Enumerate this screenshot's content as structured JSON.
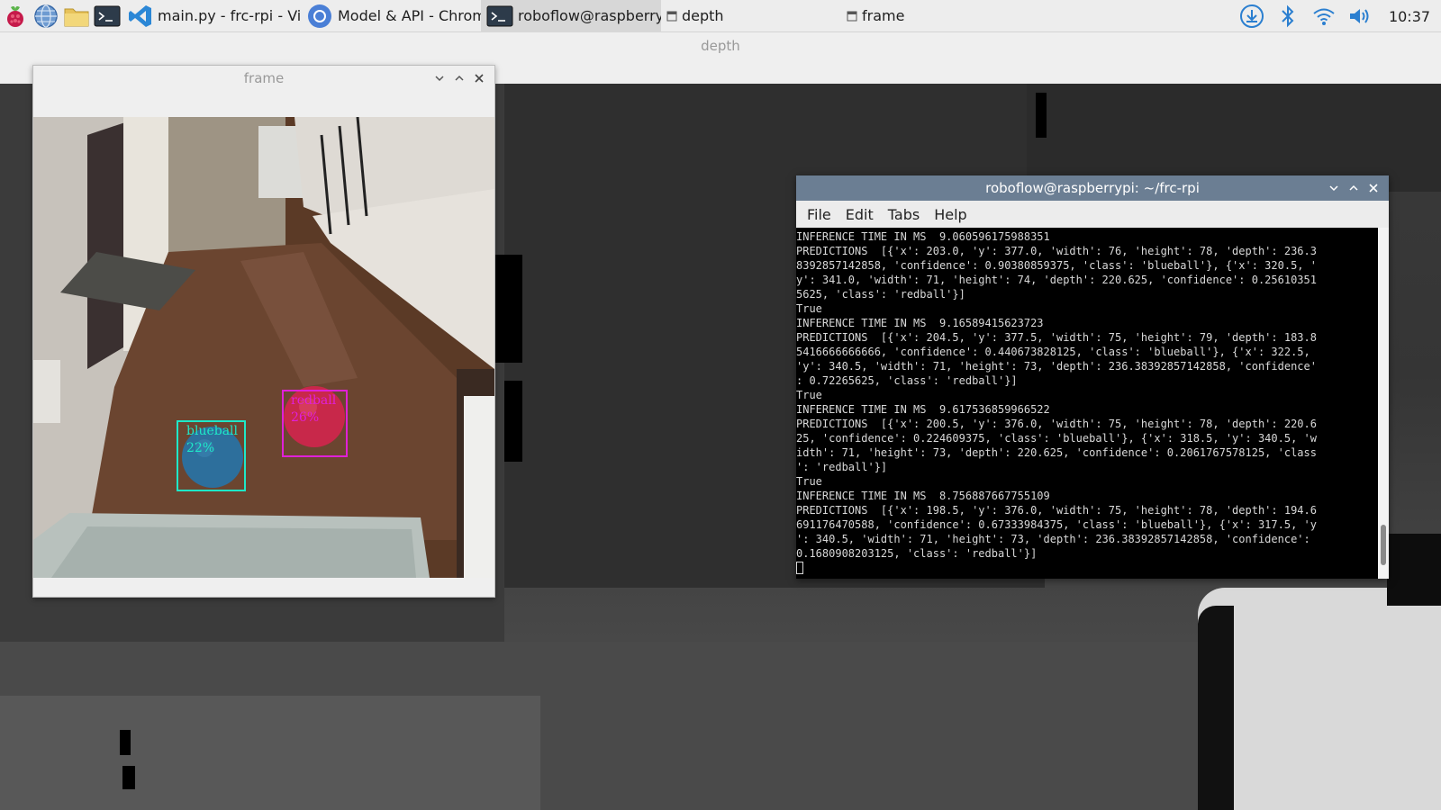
{
  "taskbar": {
    "launchers": [
      {
        "icon": "raspberry-pi-menu-icon"
      },
      {
        "icon": "web-browser-icon"
      },
      {
        "icon": "file-manager-icon"
      },
      {
        "icon": "terminal-icon"
      }
    ],
    "tasks": [
      {
        "label": "main.py - frc-rpi - Vis...",
        "icon": "vscode-icon",
        "active": false
      },
      {
        "label": "Model & API - Chromi...",
        "icon": "chromium-icon",
        "active": false
      },
      {
        "label": "roboflow@raspberry...",
        "icon": "terminal-icon",
        "active": true
      },
      {
        "label": "depth",
        "icon": "window-icon",
        "active": false
      },
      {
        "label": "frame",
        "icon": "window-icon",
        "active": false
      }
    ],
    "tray": [
      "download-icon",
      "bluetooth-icon",
      "wifi-icon",
      "volume-icon"
    ],
    "clock": "10:37"
  },
  "depth_window": {
    "title": "depth"
  },
  "frame_window": {
    "title": "frame",
    "detections": [
      {
        "label": "blueball",
        "confidence": "22%",
        "color": "#1ee8c8"
      },
      {
        "label": "redball",
        "confidence": "26%",
        "color": "#e020d8"
      }
    ]
  },
  "terminal": {
    "title": "roboflow@raspberrypi: ~/frc-rpi",
    "menu": [
      "File",
      "Edit",
      "Tabs",
      "Help"
    ],
    "lines": [
      "INFERENCE TIME IN MS  9.060596175988351",
      "PREDICTIONS  [{'x': 203.0, 'y': 377.0, 'width': 76, 'height': 78, 'depth': 236.3",
      "8392857142858, 'confidence': 0.90380859375, 'class': 'blueball'}, {'x': 320.5, '",
      "y': 341.0, 'width': 71, 'height': 74, 'depth': 220.625, 'confidence': 0.25610351",
      "5625, 'class': 'redball'}]",
      "True",
      "INFERENCE TIME IN MS  9.16589415623723",
      "PREDICTIONS  [{'x': 204.5, 'y': 377.5, 'width': 75, 'height': 79, 'depth': 183.8",
      "5416666666666, 'confidence': 0.440673828125, 'class': 'blueball'}, {'x': 322.5,",
      "'y': 340.5, 'width': 71, 'height': 73, 'depth': 236.38392857142858, 'confidence'",
      ": 0.72265625, 'class': 'redball'}]",
      "True",
      "INFERENCE TIME IN MS  9.617536859966522",
      "PREDICTIONS  [{'x': 200.5, 'y': 376.0, 'width': 75, 'height': 78, 'depth': 220.6",
      "25, 'confidence': 0.224609375, 'class': 'blueball'}, {'x': 318.5, 'y': 340.5, 'w",
      "idth': 71, 'height': 73, 'depth': 220.625, 'confidence': 0.2061767578125, 'class",
      "': 'redball'}]",
      "True",
      "INFERENCE TIME IN MS  8.756887667755109",
      "PREDICTIONS  [{'x': 198.5, 'y': 376.0, 'width': 75, 'height': 78, 'depth': 194.6",
      "691176470588, 'confidence': 0.67333984375, 'class': 'blueball'}, {'x': 317.5, 'y",
      "': 340.5, 'width': 71, 'height': 73, 'depth': 236.38392857142858, 'confidence':",
      "0.1680908203125, 'class': 'redball'}]"
    ]
  }
}
